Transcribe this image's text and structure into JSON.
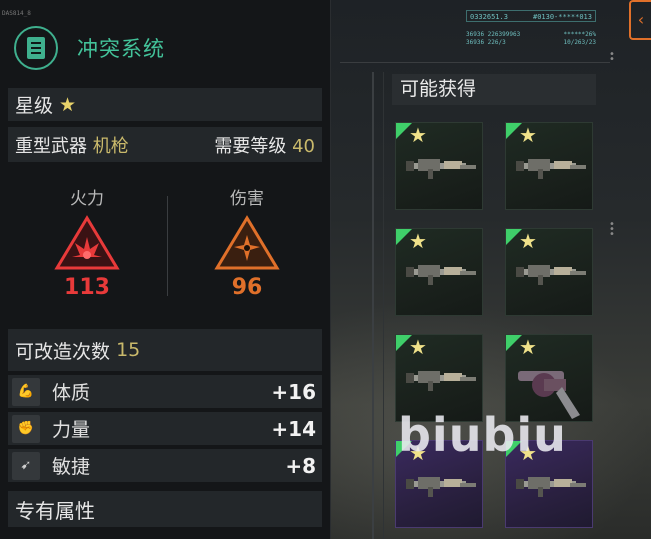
{
  "header": {
    "tag": "DAS814_8",
    "system_title": "冲突系统"
  },
  "hud": {
    "code_left": "0332651.3",
    "code_right": "#0130-*****013",
    "line1_left": "36936 226399963",
    "line1_right": "******26%",
    "line2_left": "36936 226/3",
    "line2_right": "10/263/23"
  },
  "item_info": {
    "star_label": "星级",
    "weapon_type": "重型武器",
    "weapon_subtype": "机枪",
    "level_req_label": "需要等级",
    "level_req_value": "40"
  },
  "stats": [
    {
      "label": "火力",
      "value": "113",
      "color": "#e83a3a",
      "icon": "firepower-icon"
    },
    {
      "label": "伤害",
      "value": "96",
      "color": "#e0702a",
      "icon": "damage-icon"
    }
  ],
  "mods": {
    "label": "可改造次数",
    "count": "15"
  },
  "attributes": [
    {
      "name": "体质",
      "value": "+16",
      "icon": "arm-icon"
    },
    {
      "name": "力量",
      "value": "+14",
      "icon": "fist-icon"
    },
    {
      "name": "敏捷",
      "value": "+8",
      "icon": "boot-icon"
    }
  ],
  "exclusive": {
    "label": "专有属性"
  },
  "loot": {
    "title": "可能获得",
    "items": [
      {
        "rarity": "green",
        "icon": "machine-gun-icon"
      },
      {
        "rarity": "green",
        "icon": "machine-gun-icon"
      },
      {
        "rarity": "green",
        "icon": "machine-gun-icon"
      },
      {
        "rarity": "green",
        "icon": "machine-gun-icon"
      },
      {
        "rarity": "green",
        "icon": "rifle-icon"
      },
      {
        "rarity": "green",
        "icon": "revolver-icon"
      },
      {
        "rarity": "purple",
        "icon": "machine-gun-icon"
      },
      {
        "rarity": "purple",
        "icon": "machine-gun-icon"
      }
    ]
  },
  "watermark": "biubiu",
  "colors": {
    "accent_green": "#43c39a",
    "star_gold": "#e8d36a",
    "fire_red": "#e83a3a",
    "damage_orange": "#e0702a"
  }
}
